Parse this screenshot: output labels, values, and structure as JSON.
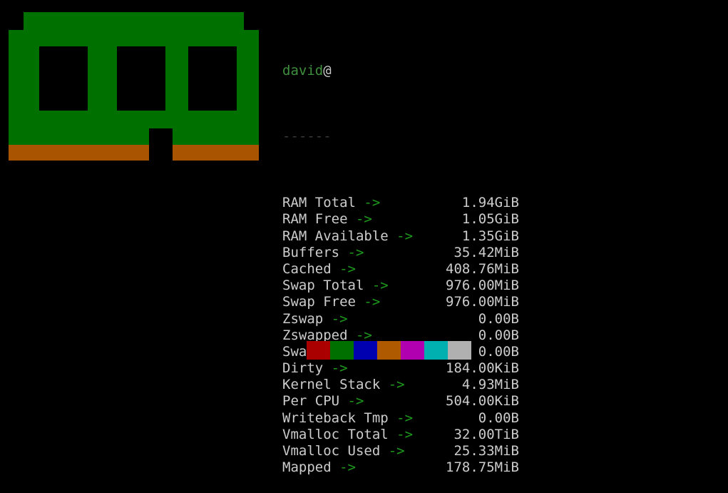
{
  "terminal": {
    "background": "#000000",
    "foreground": "#cccccc"
  },
  "header": {
    "user": "david",
    "separator_at": "@",
    "host": "",
    "rule": "------"
  },
  "logo": {
    "name": "ram-stick-ascii-art",
    "pcb_color": "#007000",
    "contacts_color": "#a85400",
    "chip_color": "#000000",
    "chip_count": 3
  },
  "arrow": "->",
  "info_rows": [
    {
      "label": "RAM Total",
      "value": "1.94GiB"
    },
    {
      "label": "RAM Free",
      "value": "1.05GiB"
    },
    {
      "label": "RAM Available",
      "value": "1.35GiB"
    },
    {
      "label": "Buffers",
      "value": "35.42MiB"
    },
    {
      "label": "Cached",
      "value": "408.76MiB"
    },
    {
      "label": "Swap Total",
      "value": "976.00MiB"
    },
    {
      "label": "Swap Free",
      "value": "976.00MiB"
    },
    {
      "label": "Zswap",
      "value": "0.00B"
    },
    {
      "label": "Zswapped",
      "value": "0.00B"
    },
    {
      "label": "Swap Cached",
      "value": "0.00B"
    },
    {
      "label": "Dirty",
      "value": "184.00KiB"
    },
    {
      "label": "Kernel Stack",
      "value": "4.93MiB"
    },
    {
      "label": "Per CPU",
      "value": "504.00KiB"
    },
    {
      "label": "Writeback Tmp",
      "value": "0.00B"
    },
    {
      "label": "Vmalloc Total",
      "value": "32.00TiB"
    },
    {
      "label": "Vmalloc Used",
      "value": "25.33MiB"
    },
    {
      "label": "Mapped",
      "value": "178.75MiB"
    }
  ],
  "palette": [
    {
      "name": "red",
      "color": "#aa0000"
    },
    {
      "name": "green",
      "color": "#007000"
    },
    {
      "name": "blue",
      "color": "#0000b0"
    },
    {
      "name": "yellow",
      "color": "#b05a00"
    },
    {
      "name": "magenta",
      "color": "#b000b0"
    },
    {
      "name": "cyan",
      "color": "#00b0b0"
    },
    {
      "name": "white",
      "color": "#b0b0b0"
    }
  ]
}
